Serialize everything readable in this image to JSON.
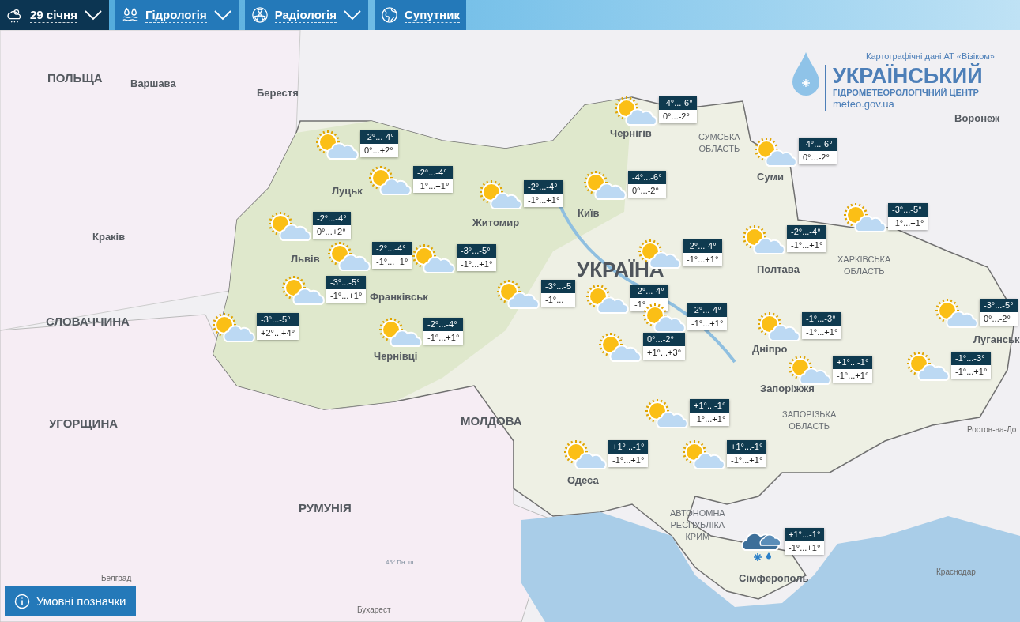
{
  "toolbar": [
    {
      "label": "29 січня",
      "dropdown": true,
      "selected": true
    },
    {
      "label": "Гідрологія",
      "dropdown": true,
      "selected": false
    },
    {
      "label": "Радіологія",
      "dropdown": true,
      "selected": false
    },
    {
      "label": "Супутник",
      "dropdown": false,
      "selected": false
    }
  ],
  "logo": {
    "credit": "Картографічні дані АТ «Візіком»",
    "title": "УКРАЇНСЬКИЙ",
    "subtitle": "ГІДРОМЕТЕОРОЛОГІЧНИЙ ЦЕНТР",
    "url": "meteo.gov.ua"
  },
  "places": [
    {
      "text": "ПОЛЬЩА",
      "kind": "country"
    },
    {
      "text": "Варшава",
      "kind": "city"
    },
    {
      "text": "Берестя",
      "kind": "city"
    },
    {
      "text": "Краків",
      "kind": "city"
    },
    {
      "text": "СЛОВАЧЧИНА",
      "kind": "country"
    },
    {
      "text": "УГОРЩИНА",
      "kind": "country"
    },
    {
      "text": "РУМУНІЯ",
      "kind": "country"
    },
    {
      "text": "МОЛДОВА",
      "kind": "country"
    },
    {
      "text": "УКРАЇНА",
      "kind": "main"
    },
    {
      "text": "Луцьк",
      "kind": "city"
    },
    {
      "text": "Львів",
      "kind": "city"
    },
    {
      "text": "Житомир",
      "kind": "city"
    },
    {
      "text": "Київ",
      "kind": "city"
    },
    {
      "text": "Чернігів",
      "kind": "city"
    },
    {
      "text": "Суми",
      "kind": "city"
    },
    {
      "text": "Полтава",
      "kind": "city"
    },
    {
      "text": "Дніпро",
      "kind": "city"
    },
    {
      "text": "Запоріжжя",
      "kind": "city"
    },
    {
      "text": "Луганськ",
      "kind": "city"
    },
    {
      "text": "Одеса",
      "kind": "city"
    },
    {
      "text": "Сімферополь",
      "kind": "city"
    },
    {
      "text": "Франківськ",
      "kind": "city"
    },
    {
      "text": "Чернівці",
      "kind": "city"
    },
    {
      "text": "Воронеж",
      "kind": "city"
    },
    {
      "text": "Ростов-на-До",
      "kind": "small"
    },
    {
      "text": "Краснодар",
      "kind": "small"
    },
    {
      "text": "Белград",
      "kind": "small"
    },
    {
      "text": "Бухарест",
      "kind": "small"
    },
    {
      "text": "СУМСЬКА\nОБЛАСТЬ",
      "kind": "region"
    },
    {
      "text": "ХАРКІВСЬКА\nОБЛАСТЬ",
      "kind": "region"
    },
    {
      "text": "ЗАПОРІЗЬКА\nОБЛАСТЬ",
      "kind": "region"
    },
    {
      "text": "АВТОНОМНА\nРЕСПУБЛІКА\nКРИМ",
      "kind": "region"
    },
    {
      "text": "45° Пн. ш.",
      "kind": "tiny"
    }
  ],
  "forecasts": [
    {
      "kind": "partly_cloudy",
      "night": "-2°...-4°",
      "day": "0°...+2°"
    },
    {
      "kind": "partly_cloudy",
      "night": "-2°...-4°",
      "day": "-1°...+1°"
    },
    {
      "kind": "partly_cloudy",
      "night": "-2°...-4°",
      "day": "-1°...+1°"
    },
    {
      "kind": "partly_cloudy",
      "night": "-4°...-6°",
      "day": "0°...-2°"
    },
    {
      "kind": "partly_cloudy",
      "night": "-4°...-6°",
      "day": "0°...-2°"
    },
    {
      "kind": "partly_cloudy",
      "night": "-4°...-6°",
      "day": "0°...-2°"
    },
    {
      "kind": "partly_cloudy",
      "night": "-3°...-5°",
      "day": "-1°...+1°"
    },
    {
      "kind": "partly_cloudy",
      "night": "-2°...-4°",
      "day": "-1°...+1°"
    },
    {
      "kind": "partly_cloudy",
      "night": "-2°...-4°",
      "day": "-1°...+1°"
    },
    {
      "kind": "partly_cloudy",
      "night": "-2°...-4°",
      "day": "0°...+2°"
    },
    {
      "kind": "partly_cloudy",
      "night": "-2°...-4°",
      "day": "-1°...+1°"
    },
    {
      "kind": "partly_cloudy",
      "night": "-3°...-5°",
      "day": "-1°...+1°"
    },
    {
      "kind": "partly_cloudy",
      "night": "-3°...-5°",
      "day": "-1°...+1°"
    },
    {
      "kind": "partly_cloudy",
      "night": "-3°...-5°",
      "day": "+2°...+4°"
    },
    {
      "kind": "partly_cloudy",
      "night": "-2°...-4°",
      "day": "-1°...+1°"
    },
    {
      "kind": "partly_cloudy",
      "night": "-3°...-5",
      "day": "-1°...+"
    },
    {
      "kind": "partly_cloudy",
      "night": "-2°...-4°",
      "day": "-1°"
    },
    {
      "kind": "partly_cloudy",
      "night": "-2°...-4°",
      "day": "-1°...+1°"
    },
    {
      "kind": "partly_cloudy",
      "night": "0°...-2°",
      "day": "+1°...+3°"
    },
    {
      "kind": "partly_cloudy",
      "night": "-1°...-3°",
      "day": "-1°...+1°"
    },
    {
      "kind": "partly_cloudy",
      "night": "-3°...-5°",
      "day": "0°...-2°"
    },
    {
      "kind": "partly_cloudy",
      "night": "+1°...-1°",
      "day": "-1°...+1°"
    },
    {
      "kind": "partly_cloudy",
      "night": "-1°...-3°",
      "day": "-1°...+1°"
    },
    {
      "kind": "partly_cloudy",
      "night": "+1°...-1°",
      "day": "-1°...+1°"
    },
    {
      "kind": "partly_cloudy",
      "night": "+1°...-1°",
      "day": "-1°...+1°"
    },
    {
      "kind": "partly_cloudy",
      "night": "+1°...-1°",
      "day": "-1°...+1°"
    },
    {
      "kind": "snow",
      "night": "+1°...-1°",
      "day": "-1°...+1°"
    }
  ],
  "legend_button": "Умовні позначки"
}
